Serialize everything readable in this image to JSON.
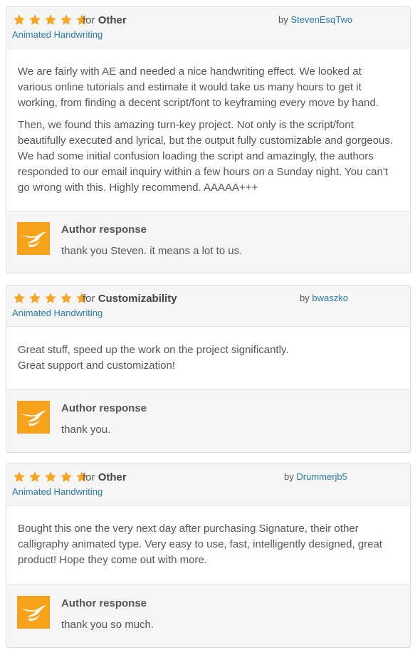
{
  "accent_colors": {
    "star": "#f5a623",
    "link": "#2a7aa8",
    "logo": "#f7a21b"
  },
  "icons": {
    "star": "star-icon",
    "author_logo": "author-bird-logo-icon"
  },
  "reviews": [
    {
      "rating": 5,
      "for_prefix": "for",
      "category": "Other",
      "by_prefix": "by",
      "author": "StevenEsqTwo",
      "item": "Animated Handwriting",
      "paragraphs": [
        "We are fairly with AE and needed a nice handwriting effect. We looked at various online tutorials and estimate it would take us many hours to get it working, from finding a decent script/font to keyframing every move by hand.",
        "Then, we found this amazing turn-key project. Not only is the script/font beautifully executed and lyrical, but the output fully customizable and gorgeous. We had some initial confusion loading the script and amazingly, the authors responded to our email inquiry within a few hours on a Sunday night. You can't go wrong with this. Highly recommend. AAAAA+++"
      ],
      "response_title": "Author response",
      "response_text": "thank you Steven. it means a lot to us."
    },
    {
      "rating": 5,
      "for_prefix": "for",
      "category": "Customizability",
      "by_prefix": "by",
      "author": "bwaszko",
      "item": "Animated Handwriting",
      "paragraphs": [
        "Great stuff, speed up the work on the project significantly.",
        "Great support and customization!"
      ],
      "response_title": "Author response",
      "response_text": "thank you."
    },
    {
      "rating": 5,
      "for_prefix": "for",
      "category": "Other",
      "by_prefix": "by",
      "author": "Drummerjb5",
      "item": "Animated Handwriting",
      "paragraphs": [
        "Bought this one the very next day after purchasing Signature, their other calligraphy animated type. Very easy to use, fast, intelligently designed, great product! Hope they come out with more."
      ],
      "response_title": "Author response",
      "response_text": "thank you so much."
    }
  ]
}
